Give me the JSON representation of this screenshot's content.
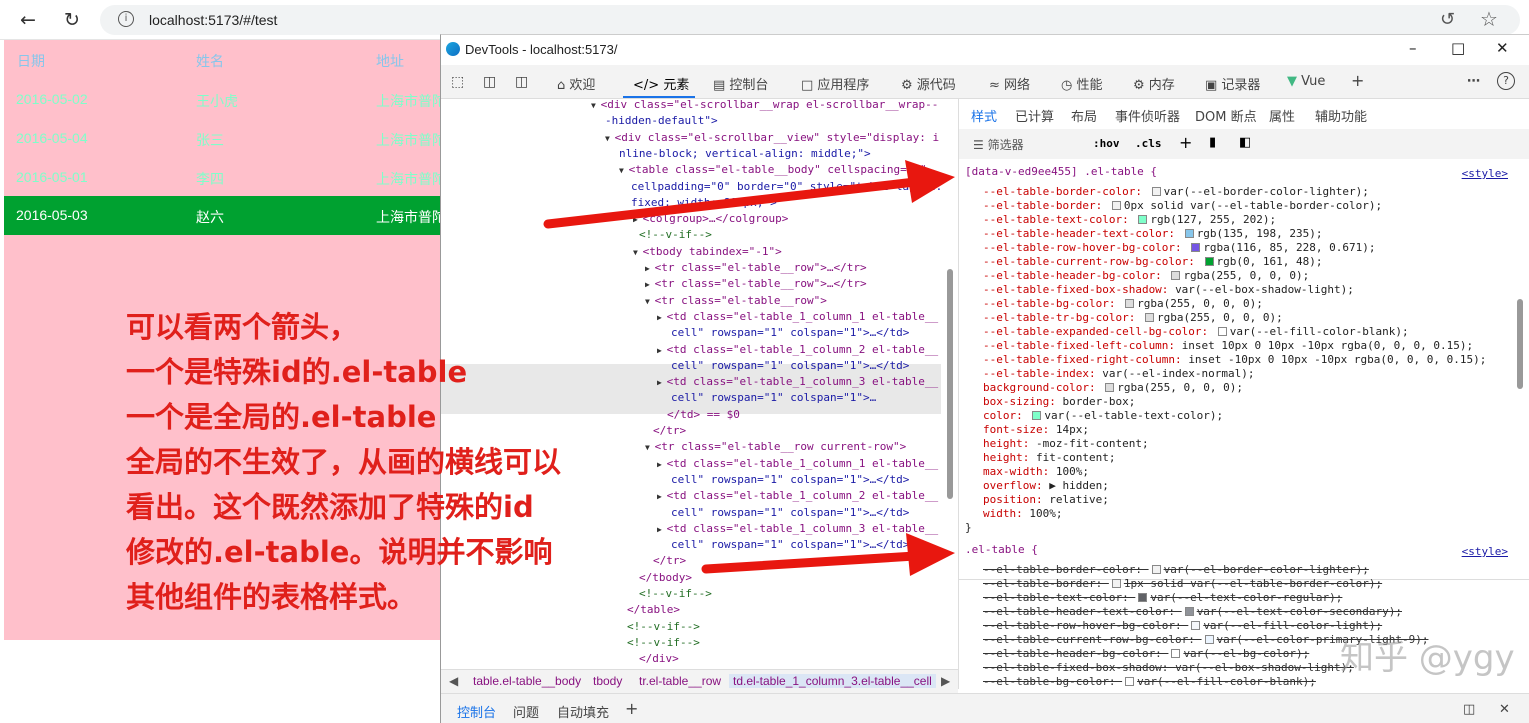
{
  "browser": {
    "url": "localhost:5173/#/test",
    "back_icon": "arrow-left-icon",
    "refresh_icon": "refresh-icon"
  },
  "table": {
    "headers": [
      "日期",
      "姓名",
      "地址"
    ],
    "rows": [
      {
        "date": "2016-05-02",
        "name": "王小虎",
        "addr": "上海市普陀"
      },
      {
        "date": "2016-05-04",
        "name": "张三",
        "addr": "上海市普陀"
      },
      {
        "date": "2016-05-01",
        "name": "李四",
        "addr": "上海市普陀"
      },
      {
        "date": "2016-05-03",
        "name": "赵六",
        "addr": "上海市普陀",
        "current": true
      }
    ]
  },
  "note": {
    "lines": [
      "可以看两个箭头，",
      "一个是特殊id的.el-table",
      "一个是全局的.el-table",
      "全局的不生效了，从画的横线可以",
      "看出。这个既然添加了特殊的id",
      "修改的.el-table。说明并不影响",
      "其他组件的表格样式。"
    ]
  },
  "devtools": {
    "title": "DevTools - localhost:5173/",
    "tabs": [
      "欢迎",
      "元素",
      "控制台",
      "应用程序",
      "源代码",
      "网络",
      "性能",
      "内存",
      "记录器",
      "Vue"
    ],
    "active_tab": "元素",
    "tree": [
      "<div class=\"el-scrollbar__wrap el-scrollbar__wrap--",
      "-hidden-default\">",
      "<div class=\"el-scrollbar__view\" style=\"display: i",
      "nline-block; vertical-align: middle;\">",
      "<table class=\"el-table__body\" cellspacing=\"0\"",
      "cellpadding=\"0\" border=\"0\" style=\"table-layout:",
      "fixed; width: 800px;\">",
      "<colgroup>…</colgroup>",
      "<!--v-if-->",
      "<tbody tabindex=\"-1\">",
      "<tr class=\"el-table__row\">…</tr>",
      "<tr class=\"el-table__row\">…</tr>",
      "<tr class=\"el-table__row\">",
      "<td class=\"el-table_1_column_1 el-table__",
      "cell\" rowspan=\"1\" colspan=\"1\">…</td>",
      "<td class=\"el-table_1_column_2 el-table__",
      "cell\" rowspan=\"1\" colspan=\"1\">…</td>",
      "<td class=\"el-table_1_column_3 el-table__",
      "cell\" rowspan=\"1\" colspan=\"1\">…",
      "</td> == $0",
      "</tr>",
      "<tr class=\"el-table__row current-row\">",
      "<td class=\"el-table_1_column_1 el-table__",
      "cell\" rowspan=\"1\" colspan=\"1\">…</td>",
      "<td class=\"el-table_1_column_2 el-table__",
      "cell\" rowspan=\"1\" colspan=\"1\">…</td>",
      "<td class=\"el-table_1_column_3 el-table__",
      "cell\" rowspan=\"1\" colspan=\"1\">…</td>",
      "</tr>",
      "</tbody>",
      "<!--v-if-->",
      "</table>",
      "<!--v-if-->",
      "<!--v-if-->",
      "</div>",
      "</div>"
    ],
    "styles_tabs": [
      "样式",
      "已计算",
      "布局",
      "事件侦听器",
      "DOM 断点",
      "属性",
      "辅助功能"
    ],
    "filter_placeholder": "筛选器",
    "hov": ":hov",
    "cls": ".cls",
    "rule1": {
      "selector": "[data-v-ed9ee455] .el-table {",
      "source": "<style>",
      "props": [
        [
          "--el-table-border-color:",
          "var(--el-border-color-lighter);",
          "#f2f2f2"
        ],
        [
          "--el-table-border:",
          "0px solid var(--el-table-border-color);",
          "#f2f2f2"
        ],
        [
          "--el-table-text-color:",
          "rgb(127, 255, 202);",
          "#7fffca"
        ],
        [
          "--el-table-header-text-color:",
          "rgb(135, 198, 235);",
          "#87c6eb"
        ],
        [
          "--el-table-row-hover-bg-color:",
          "rgba(116, 85, 228, 0.671);",
          "#7455e4"
        ],
        [
          "--el-table-current-row-bg-color:",
          "rgb(0, 161, 48);",
          "#00a130"
        ],
        [
          "--el-table-header-bg-color:",
          "rgba(255, 0, 0, 0);",
          "#dddddd"
        ],
        [
          "--el-table-fixed-box-shadow:",
          "var(--el-box-shadow-light);",
          ""
        ],
        [
          "--el-table-bg-color:",
          "rgba(255, 0, 0, 0);",
          "#dddddd"
        ],
        [
          "--el-table-tr-bg-color:",
          "rgba(255, 0, 0, 0);",
          "#dddddd"
        ],
        [
          "--el-table-expanded-cell-bg-color:",
          "var(--el-fill-color-blank);",
          "#ffffff"
        ],
        [
          "--el-table-fixed-left-column:",
          "inset 10px 0 10px -10px rgba(0, 0, 0, 0.15);",
          ""
        ],
        [
          "--el-table-fixed-right-column:",
          "inset -10px 0 10px -10px rgba(0, 0, 0, 0.15);",
          ""
        ],
        [
          "--el-table-index:",
          "var(--el-index-normal);",
          ""
        ],
        [
          "background-color:",
          "rgba(255, 0, 0, 0);",
          "#dddddd"
        ],
        [
          "box-sizing:",
          "border-box;",
          ""
        ],
        [
          "color:",
          "var(--el-table-text-color);",
          "#7fffca"
        ],
        [
          "font-size:",
          "14px;",
          ""
        ],
        [
          "height:",
          "-moz-fit-content;",
          ""
        ],
        [
          "height:",
          "fit-content;",
          ""
        ],
        [
          "max-width:",
          "100%;",
          ""
        ],
        [
          "overflow:",
          "▶ hidden;",
          ""
        ],
        [
          "position:",
          "relative;",
          ""
        ],
        [
          "width:",
          "100%;",
          ""
        ]
      ],
      "close": "}"
    },
    "rule2": {
      "selector": ".el-table {",
      "source": "<style>",
      "props": [
        [
          "--el-table-border-color:",
          "var(--el-border-color-lighter);",
          "#f2f2f2"
        ],
        [
          "--el-table-border:",
          "1px solid var(--el-table-border-color);",
          "#f2f2f2"
        ],
        [
          "--el-table-text-color:",
          "var(--el-text-color-regular);",
          "#606266"
        ],
        [
          "--el-table-header-text-color:",
          "var(--el-text-color-secondary);",
          "#909399"
        ],
        [
          "--el-table-row-hover-bg-color:",
          "var(--el-fill-color-light);",
          "#f5f7fa"
        ],
        [
          "--el-table-current-row-bg-color:",
          "var(--el-color-primary-light-9);",
          "#ecf5ff"
        ],
        [
          "--el-table-header-bg-color:",
          "var(--el-bg-color);",
          "#ffffff"
        ],
        [
          "--el-table-fixed-box-shadow:",
          "var(--el-box-shadow-light);",
          ""
        ],
        [
          "--el-table-bg-color:",
          "var(--el-fill-color-blank);",
          "#ffffff"
        ]
      ]
    },
    "crumbs": [
      "table.el-table__body",
      "tbody",
      "tr.el-table__row",
      "td.el-table_1_column_3.el-table__cell"
    ],
    "drawer_tabs": [
      "控制台",
      "问题",
      "自动填充"
    ]
  },
  "watermark": "知乎 @ygy",
  "colors": {
    "page_bg": "#ffc0cb",
    "header_text": "#87c6eb",
    "cell_text": "#7fffca",
    "current_row": "#00a130",
    "note": "#e0201b",
    "arrow": "#e8170f"
  }
}
